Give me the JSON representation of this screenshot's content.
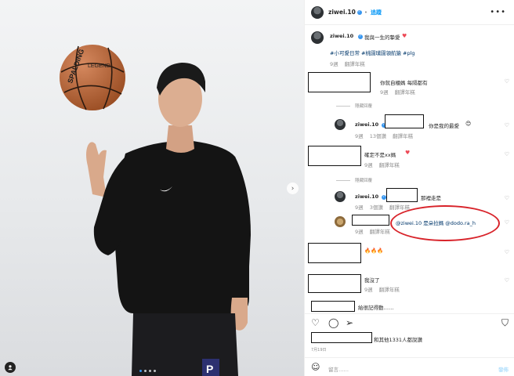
{
  "colors": {
    "accent": "#0095f6",
    "heart": "#ed4956",
    "circle": "#d8232a"
  },
  "post_header": {
    "username": "ziwei.10",
    "follow_label": "追蹤",
    "more_icon": "more-icon"
  },
  "caption": {
    "username": "ziwei.10",
    "text": "我與一生的摯愛",
    "hashtags": "#小可愛日常 #桃園璞園領航猿 #plg",
    "time": "9週",
    "translate": "翻譯年糕"
  },
  "comments": [
    {
      "text": "你就自櫃媽 每隔都有",
      "meta": [
        "9週",
        "翻譯年糕"
      ],
      "hidden": "隱藏回覆"
    },
    {
      "reply_user": "ziwei.10",
      "text": "你是我的最愛",
      "meta": [
        "9週",
        "13個讚",
        "翻譯年糕"
      ]
    },
    {
      "text": "確定不是xx媽",
      "meta": [
        "9週",
        "翻譯年糕"
      ],
      "hidden": "隱藏回覆"
    },
    {
      "reply_user": "ziwei.10",
      "text": "那裡走是",
      "meta": [
        "9週",
        "3個讚",
        "翻譯年糕"
      ]
    },
    {
      "reply_text": "@ziwei.10 是朵拉媽 @dodo.ra_h",
      "meta": [
        "9週",
        "翻譯年糕"
      ]
    },
    {
      "text": "🔥🔥🔥"
    },
    {
      "text": "我沒了",
      "meta": [
        "9週",
        "翻譯年糕"
      ]
    },
    {
      "text": "給很記得動……"
    }
  ],
  "likes_text": "和其他1331人都說讚",
  "date": "7月19日",
  "comment_input": {
    "placeholder": "留言……",
    "post_label": "發佈"
  }
}
